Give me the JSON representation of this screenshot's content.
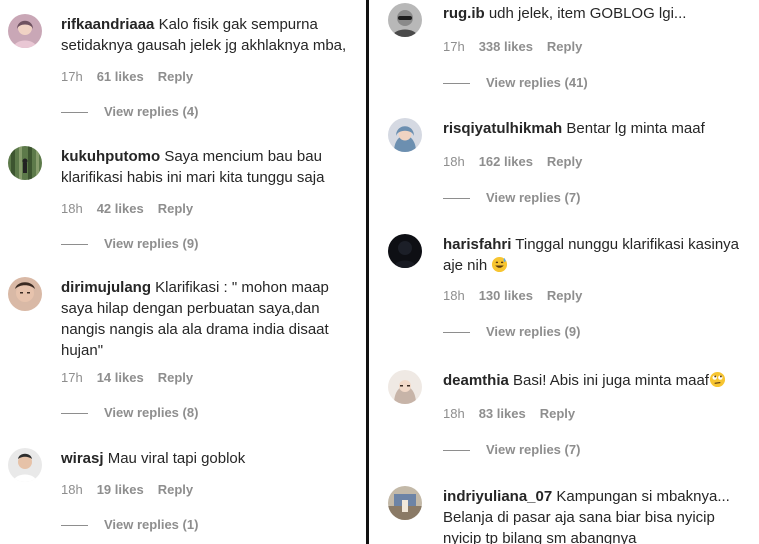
{
  "left_comments": [
    {
      "username": "rifkaandriaaa",
      "text": "Kalo fisik gak sempurna setidaknya gausah jelek jg akhlaknya mba,",
      "time": "17h",
      "likes": "61 likes",
      "reply": "Reply",
      "view_replies": "View replies (4)"
    },
    {
      "username": "kukuhputomo",
      "text": "Saya mencium bau bau klarifikasi habis ini mari kita tunggu saja",
      "time": "18h",
      "likes": "42 likes",
      "reply": "Reply",
      "view_replies": "View replies (9)"
    },
    {
      "username": "dirimujulang",
      "text": "Klarifikasi : \" mohon maap saya hilap dengan perbuatan saya,dan nangis nangis ala ala drama india disaat hujan\"",
      "time": "17h",
      "likes": "14 likes",
      "reply": "Reply",
      "view_replies": "View replies (8)"
    },
    {
      "username": "wirasj",
      "text": "Mau viral tapi goblok",
      "time": "18h",
      "likes": "19 likes",
      "reply": "Reply",
      "view_replies": "View replies (1)"
    }
  ],
  "right_comments": [
    {
      "username": "rug.ib",
      "text": "udh jelek, item GOBLOG lgi...",
      "time": "17h",
      "likes": "338 likes",
      "reply": "Reply",
      "view_replies": "View replies (41)"
    },
    {
      "username": "risqiyatulhikmah",
      "text": "Bentar lg minta maaf",
      "time": "18h",
      "likes": "162 likes",
      "reply": "Reply",
      "view_replies": "View replies (7)"
    },
    {
      "username": "harisfahri",
      "text": "Tinggal nunggu klarifikasi kasinya aje nih",
      "emoji": "sweat-smile-emoji",
      "time": "18h",
      "likes": "130 likes",
      "reply": "Reply",
      "view_replies": "View replies (9)"
    },
    {
      "username": "deamthia",
      "text": "Basi! Abis ini juga minta maaf",
      "emoji": "eye-roll-emoji",
      "time": "18h",
      "likes": "83 likes",
      "reply": "Reply",
      "view_replies": "View replies (7)"
    },
    {
      "username": "indriyuliana_07",
      "text": "Kampungan si mbaknya... Belanja di pasar aja sana biar bisa nyicip nyicip tp bilang sm abangnya"
    }
  ],
  "colors": {
    "text": "#262626",
    "secondary": "#8e8e8e",
    "divider": "#111111"
  }
}
